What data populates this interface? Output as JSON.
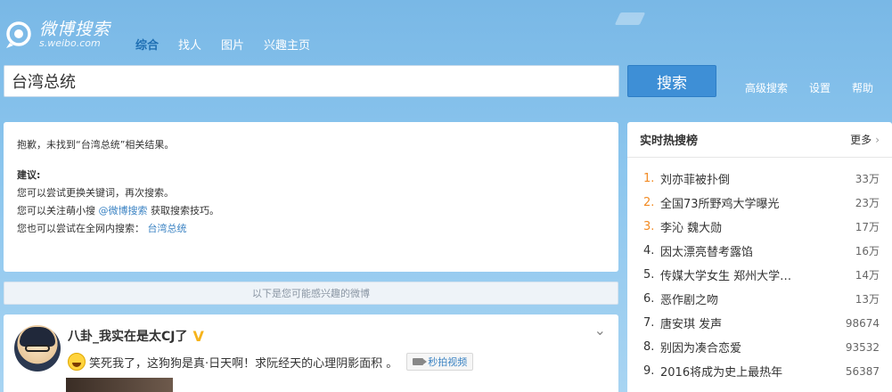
{
  "header": {
    "logo_title": "微博搜索",
    "logo_sub": "s.weibo.com",
    "nav": [
      {
        "label": "综合",
        "active": true
      },
      {
        "label": "找人",
        "active": false
      },
      {
        "label": "图片",
        "active": false
      },
      {
        "label": "兴趣主页",
        "active": false
      }
    ]
  },
  "search": {
    "value": "台湾总统",
    "button_label": "搜索",
    "links": [
      "高级搜索",
      "设置",
      "帮助"
    ]
  },
  "result": {
    "sorry_text": "抱歉，未找到“台湾总统”相关结果。",
    "suggest_title": "建议:",
    "line1": "您可以尝试更换关键词，再次搜索。",
    "line2_prefix": "您可以关注萌小搜",
    "line2_link": "@微博搜索",
    "line2_suffix": "获取搜索技巧。",
    "line3_prefix": "您也可以尝试在全网内搜索：",
    "line3_link": "台湾总统"
  },
  "divider_text": "以下是您可能感兴趣的微博",
  "feed": {
    "name": "八卦_我实在是太CJ了",
    "text": "笑死我了，这狗狗是真·日天啊！求阮经天的心理阴影面积 。",
    "video_label": "秒拍视频"
  },
  "hot": {
    "title": "实时热搜榜",
    "more": "更多",
    "items": [
      {
        "rank": "1.",
        "text": "刘亦菲被扑倒",
        "count": "33万"
      },
      {
        "rank": "2.",
        "text": "全国73所野鸡大学曝光",
        "count": "23万"
      },
      {
        "rank": "3.",
        "text": "李沁 魏大勋",
        "count": "17万"
      },
      {
        "rank": "4.",
        "text": "因太漂亮替考露馅",
        "count": "16万"
      },
      {
        "rank": "5.",
        "text": "传媒大学女生 郑州大学…",
        "count": "14万"
      },
      {
        "rank": "6.",
        "text": "恶作剧之吻",
        "count": "13万"
      },
      {
        "rank": "7.",
        "text": "唐安琪 发声",
        "count": "98674"
      },
      {
        "rank": "8.",
        "text": "别因为凑合恋爱",
        "count": "93532"
      },
      {
        "rank": "9.",
        "text": "2016将成为史上最热年",
        "count": "56387"
      }
    ]
  }
}
